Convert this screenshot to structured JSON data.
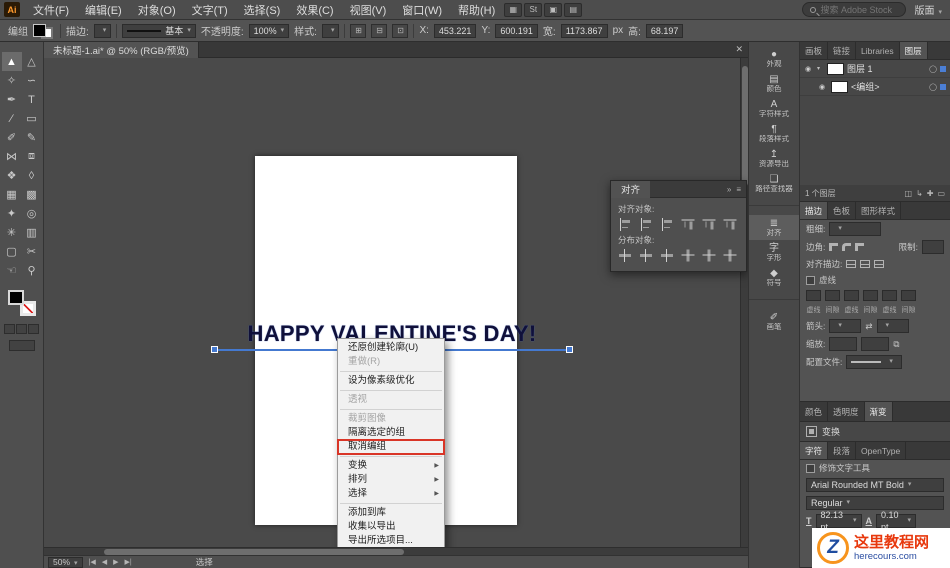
{
  "icons": {
    "caret": "▾",
    "submenu": "▶",
    "close": "✕",
    "chevrons": "»",
    "panel_menu": "≡",
    "eye": "◉",
    "target": "◯",
    "expand": "▾",
    "swap": "⇄",
    "link": "⧉"
  },
  "menubar": {
    "logo": "Ai",
    "menus": [
      "文件(F)",
      "编辑(E)",
      "对象(O)",
      "文字(T)",
      "选择(S)",
      "效果(C)",
      "视图(V)",
      "窗口(W)",
      "帮助(H)"
    ],
    "appbar_icons": [
      {
        "name": "bridge-icon",
        "glyph": "▦"
      },
      {
        "name": "stock-icon",
        "glyph": "St"
      },
      {
        "name": "folder-icon",
        "glyph": "▣"
      },
      {
        "name": "arrange-documents-icon",
        "glyph": "▤"
      }
    ],
    "search_placeholder": "搜索 Adobe Stock",
    "workspace": "版面"
  },
  "controlbar": {
    "context_label": "编组",
    "stroke_label": "描边:",
    "brush_value": "基本",
    "opacity_label": "不透明度:",
    "opacity_value": "100%",
    "style_label": "样式:",
    "cluster_icons": [
      {
        "name": "align-objects-icon",
        "glyph": "⊞"
      },
      {
        "name": "distribute-objects-icon",
        "glyph": "⊟"
      },
      {
        "name": "transform-options-icon",
        "glyph": "⊡"
      }
    ],
    "x_label": "X:",
    "x_value": "453.221",
    "y_label": "Y:",
    "y_value": "600.191",
    "w_label": "宽:",
    "w_value": "1173.867",
    "h_label": "高:",
    "h_value": "68.197",
    "unit": "px"
  },
  "toolbar": {
    "tools": [
      {
        "name": "selection-tool",
        "glyph": "▲"
      },
      {
        "name": "direct-selection-tool",
        "glyph": "△"
      },
      {
        "name": "magic-wand-tool",
        "glyph": "✧"
      },
      {
        "name": "lasso-tool",
        "glyph": "∽"
      },
      {
        "name": "pen-tool",
        "glyph": "✒"
      },
      {
        "name": "type-tool",
        "glyph": "T"
      },
      {
        "name": "line-segment-tool",
        "glyph": "∕"
      },
      {
        "name": "rectangle-tool",
        "glyph": "▭"
      },
      {
        "name": "paintbrush-tool",
        "glyph": "✐"
      },
      {
        "name": "pencil-tool",
        "glyph": "✎"
      },
      {
        "name": "width-tool",
        "glyph": "⋈"
      },
      {
        "name": "free-transform-tool",
        "glyph": "⧈"
      },
      {
        "name": "shape-builder-tool",
        "glyph": "❖"
      },
      {
        "name": "perspective-grid-tool",
        "glyph": "◊"
      },
      {
        "name": "mesh-tool",
        "glyph": "▦"
      },
      {
        "name": "gradient-tool",
        "glyph": "▩"
      },
      {
        "name": "eyedropper-tool",
        "glyph": "✦"
      },
      {
        "name": "blend-tool",
        "glyph": "◎"
      },
      {
        "name": "symbol-sprayer-tool",
        "glyph": "✳"
      },
      {
        "name": "column-graph-tool",
        "glyph": "▥"
      },
      {
        "name": "artboard-tool",
        "glyph": "▢"
      },
      {
        "name": "slice-tool",
        "glyph": "✂"
      },
      {
        "name": "hand-tool",
        "glyph": "☜"
      },
      {
        "name": "zoom-tool",
        "glyph": "⚲"
      }
    ]
  },
  "document": {
    "tab_title": "未标题-1.ai* @ 50% (RGB/预览)",
    "artboard_text": "HAPPY VALENTINE'S DAY!"
  },
  "context_menu": {
    "items": [
      {
        "label": "还原创建轮廓(U)"
      },
      {
        "label": "重做(R)",
        "disabled": true
      },
      {
        "label": "设为像素级优化"
      },
      {
        "label": "透视",
        "disabled": true
      },
      {
        "label": "裁剪图像",
        "disabled": true
      },
      {
        "label": "隔离选定的组"
      },
      {
        "label": "取消编组",
        "highlighted": true
      },
      {
        "label": "变换",
        "submenu": true
      },
      {
        "label": "排列",
        "submenu": true
      },
      {
        "label": "选择",
        "submenu": true
      },
      {
        "label": "添加到库"
      },
      {
        "label": "收集以导出"
      },
      {
        "label": "导出所选项目..."
      }
    ],
    "highlight_color": "#d93527"
  },
  "align_panel": {
    "title": "对齐",
    "align_objects_label": "对齐对象:",
    "distribute_objects_label": "分布对象:"
  },
  "right_strip": {
    "groups": [
      {
        "items": [
          {
            "name": "appearance",
            "label": "外观",
            "glyph": "●"
          },
          {
            "name": "color",
            "label": "颜色",
            "glyph": "▤"
          },
          {
            "name": "character-styles",
            "label": "字符样式",
            "glyph": "A"
          },
          {
            "name": "paragraph-styles",
            "label": "段落样式",
            "glyph": "¶"
          },
          {
            "name": "asset-export",
            "label": "资源导出",
            "glyph": "↥"
          },
          {
            "name": "pathfinder",
            "label": "路径查找器",
            "glyph": "❑"
          }
        ]
      },
      {
        "items": [
          {
            "name": "align",
            "label": "对齐",
            "glyph": "≣"
          },
          {
            "name": "glyphs",
            "label": "字形",
            "glyph": "字"
          },
          {
            "name": "symbols",
            "label": "符号",
            "glyph": "◆"
          }
        ]
      },
      {
        "items": [
          {
            "name": "brushes",
            "label": "画笔",
            "glyph": "✐"
          }
        ]
      }
    ]
  },
  "dock": {
    "layers": {
      "tabs": [
        "画板",
        "链接",
        "Libraries",
        "图层"
      ],
      "rows": [
        {
          "name": "图层 1"
        },
        {
          "name": "<编组>"
        }
      ],
      "footer": "1 个图层",
      "footer_icons": [
        {
          "name": "make-mask-icon",
          "glyph": "◫"
        },
        {
          "name": "new-sublayer-icon",
          "glyph": "↳"
        },
        {
          "name": "new-layer-icon",
          "glyph": "✚"
        },
        {
          "name": "delete-layer-icon",
          "glyph": "▭"
        }
      ]
    },
    "stroke": {
      "tabs": [
        "描边",
        "色板",
        "图形样式"
      ],
      "weight_label": "粗细:",
      "corner_label": "边角:",
      "limit_label": "限制:",
      "align_label": "对齐描边:",
      "dashed_label": "虚线",
      "dash_labels": [
        "虚线",
        "间隙",
        "虚线",
        "间隙",
        "虚线",
        "间隙"
      ],
      "arrow_label": "箭头:",
      "scale_label": "缩放:",
      "profile_label": "配置文件:"
    },
    "gradient_tabs": [
      "颜色",
      "透明度",
      "渐变"
    ],
    "transform_label": "变换",
    "character": {
      "tabs": [
        "字符",
        "段落",
        "OpenType"
      ],
      "touch_label": "修饰文字工具",
      "font": "Arial Rounded MT Bold",
      "style": "Regular",
      "size_icon": "T",
      "size_value": "82.13 pt",
      "leading_icon": "A",
      "leading_value": "0.10 pt"
    }
  },
  "status_bar": {
    "zoom": "50%",
    "nav": [
      "|◀",
      "◀",
      "▶",
      "▶|"
    ],
    "status": "选择"
  },
  "watermark": {
    "logo_glyph": "Z",
    "line1": "这里教程网",
    "line2": "herecours.com",
    "orange": "#f7941d",
    "red": "#e8380d",
    "blue": "#2b4ea2"
  }
}
